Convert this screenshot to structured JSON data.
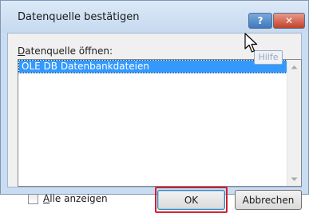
{
  "window": {
    "title": "Datenquelle bestätigen",
    "help_button": "?",
    "close_button": "✕",
    "tooltip": "Hilfe"
  },
  "main": {
    "open_label_pre": "",
    "open_label_u": "D",
    "open_label_post": "atenquelle öffnen:",
    "list_items": [
      "OLE DB Datenbankdateien"
    ],
    "selected_index": 0
  },
  "footer": {
    "show_all_u": "A",
    "show_all_rest": "lle anzeigen",
    "show_all_checked": false,
    "ok_label": "OK",
    "cancel_label": "Abbrechen"
  },
  "colors": {
    "selection": "#3399ff",
    "highlight_box": "#d0202a"
  }
}
